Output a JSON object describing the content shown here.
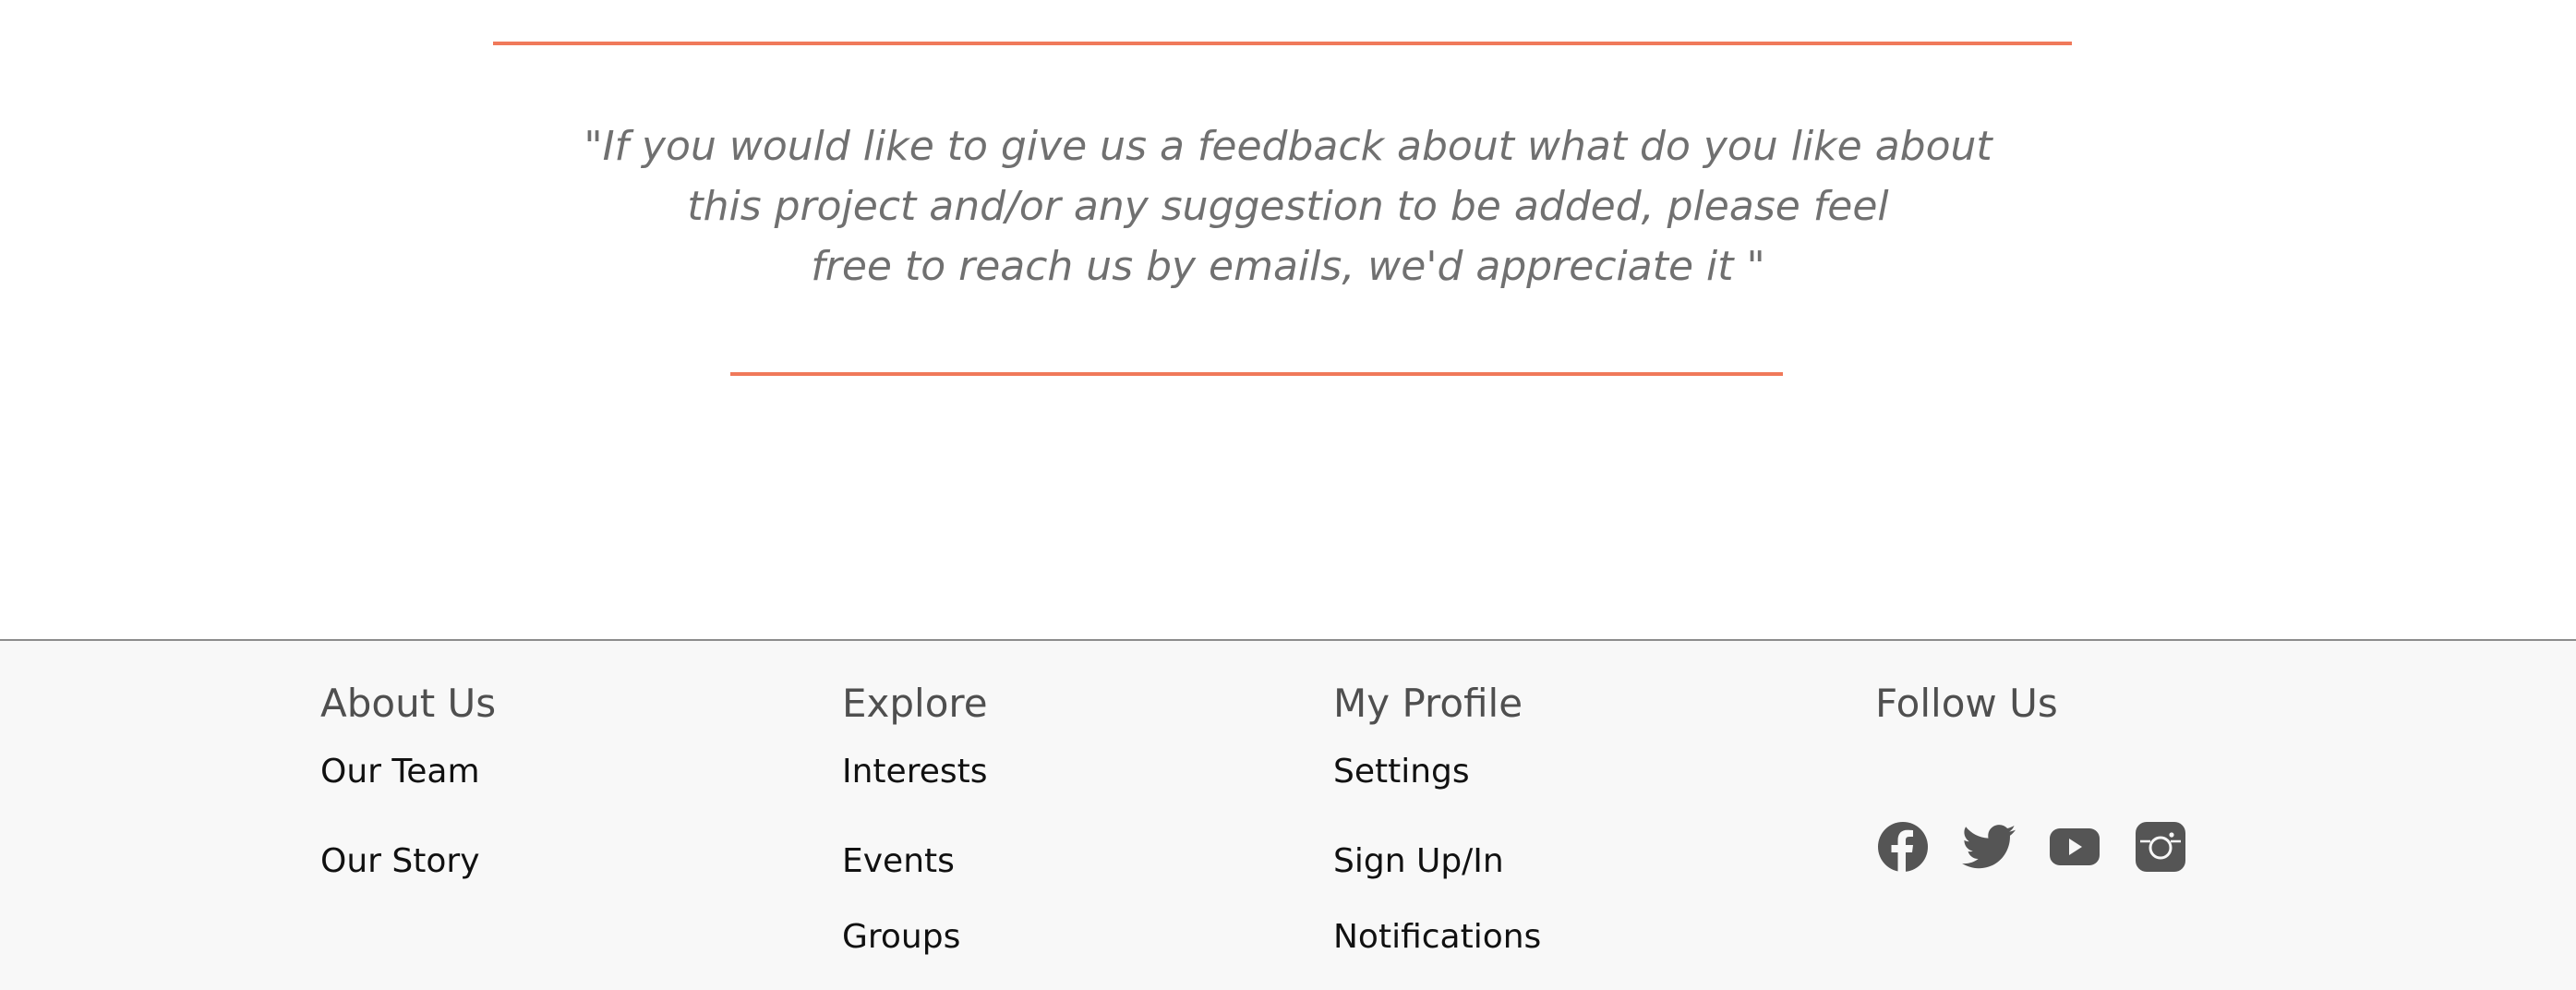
{
  "quote": {
    "lines": [
      "\"If you would like to give us a feedback about what do you like about",
      "this project and/or any suggestion to be added, please feel",
      "free to reach us by emails, we'd appreciate it \""
    ]
  },
  "colors": {
    "accent_rule": "#f0795a",
    "quote_text": "#707070",
    "footer_bg": "#f8f8f8",
    "footer_heading": "#4f4f4f",
    "icon": "#555555"
  },
  "footer": {
    "about": {
      "heading": "About Us",
      "links": [
        "Our Team",
        "Our Story"
      ]
    },
    "explore": {
      "heading": "Explore",
      "links": [
        "Interests",
        "Events",
        "Groups"
      ]
    },
    "profile": {
      "heading": "My Profile",
      "links": [
        "Settings",
        "Sign Up/In",
        "Notifications"
      ]
    },
    "follow": {
      "heading": "Follow Us",
      "icons": [
        "facebook-icon",
        "twitter-icon",
        "youtube-icon",
        "instagram-icon"
      ]
    }
  }
}
